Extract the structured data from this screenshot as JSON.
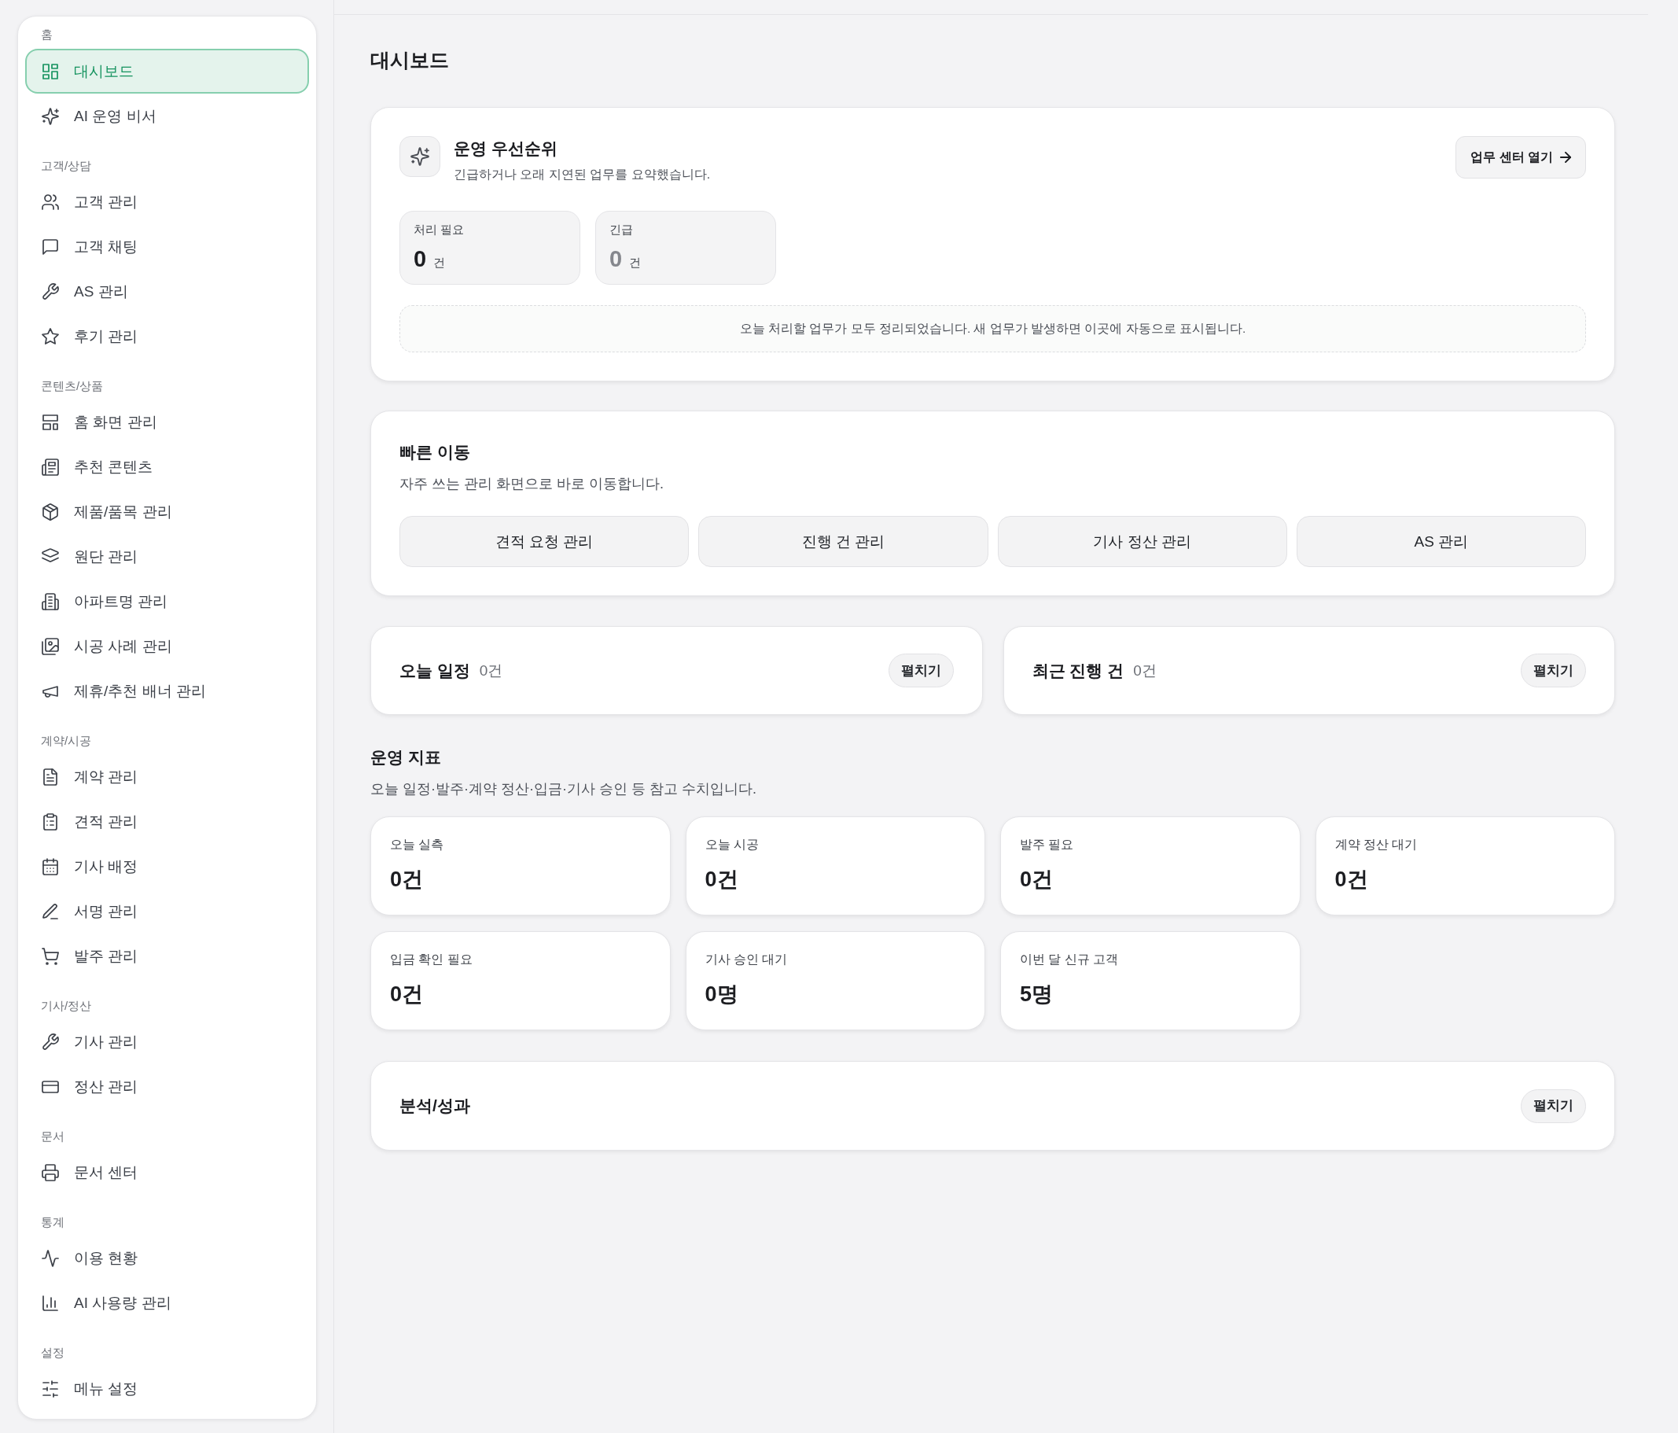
{
  "sidebar": {
    "sections": [
      {
        "label": "홈",
        "items": [
          {
            "label": "대시보드",
            "selected": true
          },
          {
            "label": "AI 운영 비서",
            "selected": false
          }
        ]
      },
      {
        "label": "고객/상담",
        "items": [
          {
            "label": "고객 관리",
            "selected": false
          },
          {
            "label": "고객 채팅",
            "selected": false
          },
          {
            "label": "AS 관리",
            "selected": false
          },
          {
            "label": "후기 관리",
            "selected": false
          }
        ]
      },
      {
        "label": "콘텐츠/상품",
        "items": [
          {
            "label": "홈 화면 관리",
            "selected": false
          },
          {
            "label": "추천 콘텐츠",
            "selected": false
          },
          {
            "label": "제품/품목 관리",
            "selected": false
          },
          {
            "label": "원단 관리",
            "selected": false
          },
          {
            "label": "아파트명 관리",
            "selected": false
          },
          {
            "label": "시공 사례 관리",
            "selected": false
          },
          {
            "label": "제휴/추천 배너 관리",
            "selected": false
          }
        ]
      },
      {
        "label": "계약/시공",
        "items": [
          {
            "label": "계약 관리",
            "selected": false
          },
          {
            "label": "견적 관리",
            "selected": false
          },
          {
            "label": "기사 배정",
            "selected": false
          },
          {
            "label": "서명 관리",
            "selected": false
          },
          {
            "label": "발주 관리",
            "selected": false
          }
        ]
      },
      {
        "label": "기사/정산",
        "items": [
          {
            "label": "기사 관리",
            "selected": false
          },
          {
            "label": "정산 관리",
            "selected": false
          }
        ]
      },
      {
        "label": "문서",
        "items": [
          {
            "label": "문서 센터",
            "selected": false
          }
        ]
      },
      {
        "label": "통계",
        "items": [
          {
            "label": "이용 현황",
            "selected": false
          },
          {
            "label": "AI 사용량 관리",
            "selected": false
          }
        ]
      },
      {
        "label": "설정",
        "items": [
          {
            "label": "메뉴 설정",
            "selected": false
          }
        ]
      }
    ]
  },
  "page": {
    "title": "대시보드"
  },
  "priority_card": {
    "title": "운영 우선순위",
    "subtitle": "긴급하거나 오래 지연된 업무를 요약했습니다.",
    "action": "업무 센터 열기",
    "stats": [
      {
        "label": "처리 필요",
        "value": "0",
        "unit": "건",
        "muted": false
      },
      {
        "label": "긴급",
        "value": "0",
        "unit": "건",
        "muted": true
      }
    ],
    "notice": "오늘 처리할 업무가 모두 정리되었습니다. 새 업무가 발생하면 이곳에 자동으로 표시됩니다."
  },
  "quick_links": {
    "title": "빠른 이동",
    "subtitle": "자주 쓰는 관리 화면으로 바로 이동합니다.",
    "buttons": [
      "견적 요청 관리",
      "진행 건 관리",
      "기사 정산 관리",
      "AS 관리"
    ]
  },
  "collapsible_panels": [
    {
      "title": "오늘 일정",
      "count": "0건",
      "toggle": "펼치기"
    },
    {
      "title": "최근 진행 건",
      "count": "0건",
      "toggle": "펼치기"
    }
  ],
  "metrics": {
    "title": "운영 지표",
    "subtitle": "오늘 일정·발주·계약 정산·입금·기사 승인 등 참고 수치입니다.",
    "cards": [
      {
        "label": "오늘 실측",
        "value": "0건"
      },
      {
        "label": "오늘 시공",
        "value": "0건"
      },
      {
        "label": "발주 필요",
        "value": "0건"
      },
      {
        "label": "계약 정산 대기",
        "value": "0건"
      },
      {
        "label": "입금 확인 필요",
        "value": "0건"
      },
      {
        "label": "기사 승인 대기",
        "value": "0명"
      },
      {
        "label": "이번 달 신규 고객",
        "value": "5명"
      }
    ]
  },
  "analysis_panel": {
    "title": "분석/성과",
    "toggle": "펼치기"
  }
}
